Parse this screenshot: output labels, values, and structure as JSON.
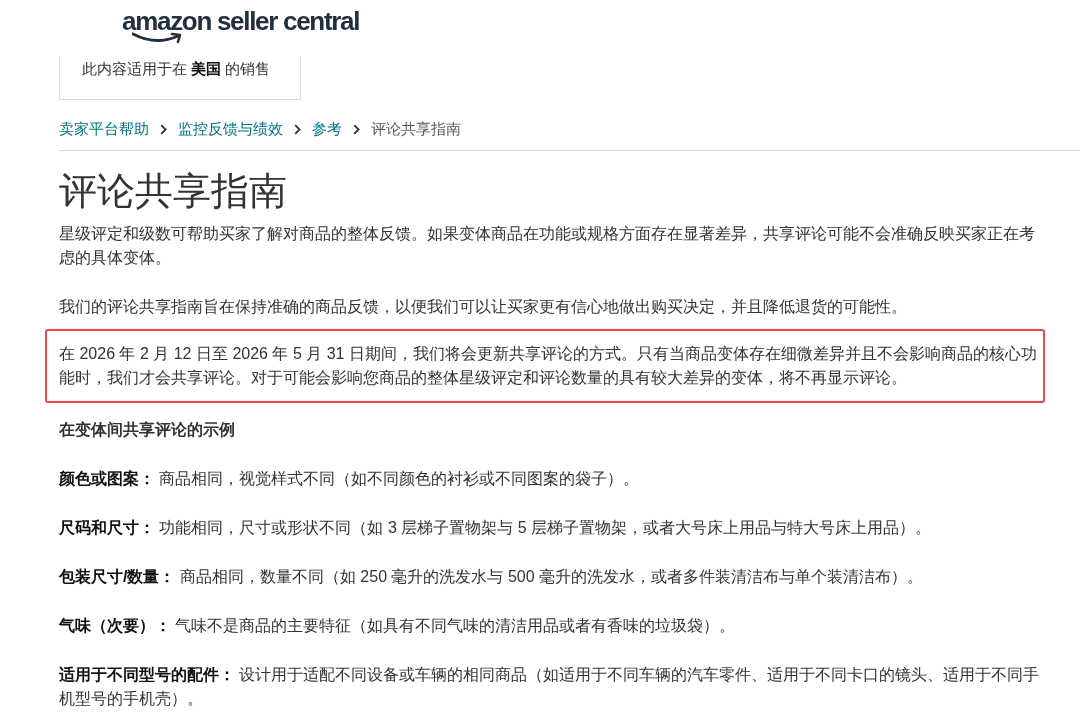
{
  "logo": {
    "text": "amazon seller central"
  },
  "region_notice": {
    "text": "此内容适用于在 **美国** 的销售"
  },
  "breadcrumb": [
    {
      "label": "卖家平台帮助",
      "kind": "link"
    },
    {
      "label": "监控反馈与绩效",
      "kind": "link"
    },
    {
      "label": "参考",
      "kind": "link"
    },
    {
      "label": "评论共享指南",
      "kind": "current"
    }
  ],
  "title": "评论共享指南",
  "paragraphs": [
    {
      "text": "星级评定和级数可帮助买家了解对商品的整体反馈。如果变体商品在功能或规格方面存在显著差异，共享评论可能不会准确反映买家正在考虑的具体变体。",
      "highlighted": false
    },
    {
      "text": "我们的评论共享指南旨在保持准确的商品反馈，以便我们可以让买家更有信心地做出购买决定，并且降低退货的可能性。",
      "highlighted": false
    },
    {
      "text": "在 2026 年 2 月 12 日至 2026 年 5 月 31 日期间，我们将会更新共享评论的方式。只有当商品变体存在细微差异并且不会影响商品的核心功能时，我们才会共享评论。对于可能会影响您商品的整体星级评定和评论数量的具有较大差异的变体，将不再显示评论。",
      "highlighted": true
    }
  ],
  "examples": {
    "heading": "在变体间共享评论的示例",
    "items": [
      "**颜色或图案：** 商品相同，视觉样式不同（如不同颜色的衬衫或不同图案的袋子）。",
      "**尺码和尺寸：** 功能相同，尺寸或形状不同（如 3 层梯子置物架与 5 层梯子置物架，或者大号床上用品与特大号床上用品）。",
      "**包装尺寸/数量：** 商品相同，数量不同（如 250 毫升的洗发水与 500 毫升的洗发水，或者多件装清洁布与单个装清洁布）。",
      "**气味（次要）：** 气味不是商品的主要特征（如具有不同气味的清洁用品或者有香味的垃圾袋）。",
      "**适用于不同型号的配件：** 设计用于适配不同设备或车辆的相同商品（如适用于不同车辆的汽车零件、适用于不同卡口的镜头、适用于不同手机型号的手机壳）。"
    ]
  }
}
